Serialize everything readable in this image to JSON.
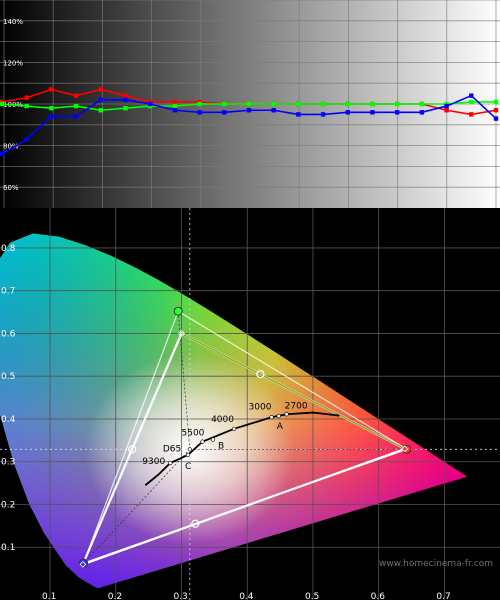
{
  "chart_data": [
    {
      "type": "line",
      "title": "",
      "xlabel": "",
      "ylabel": "",
      "ylim": [
        50,
        150
      ],
      "yticks": [
        "140%",
        "120%",
        "100%",
        "80%",
        "60%"
      ],
      "ytick_values": [
        140,
        120,
        100,
        80,
        60
      ],
      "grid": true,
      "background": "grayscale gradient black to white",
      "x": [
        0,
        1,
        2,
        3,
        4,
        5,
        6,
        7,
        8,
        9,
        10,
        11,
        12,
        13,
        14,
        15,
        16,
        17,
        18,
        19,
        20
      ],
      "series": [
        {
          "color": "#ff0000",
          "values": [
            101,
            103,
            107,
            104,
            107,
            104,
            101,
            101,
            101,
            100,
            100,
            100,
            100,
            100,
            100,
            100,
            100,
            100,
            97,
            95,
            97
          ]
        },
        {
          "color": "#00ff00",
          "values": [
            100,
            99,
            98,
            99,
            97,
            98,
            99,
            99,
            100,
            100,
            100,
            100,
            100,
            100,
            100,
            100,
            100,
            100,
            100,
            101,
            101
          ]
        },
        {
          "color": "#0000ff",
          "values": [
            76,
            83,
            94,
            94,
            102,
            102,
            100,
            97,
            96,
            96,
            97,
            97,
            95,
            95,
            96,
            96,
            96,
            96,
            99,
            104,
            93
          ]
        }
      ]
    },
    {
      "type": "scatter",
      "title": "",
      "xlim": [
        0.03,
        0.78
      ],
      "ylim": [
        0.0,
        0.87
      ],
      "xticks": [
        "0.1",
        "0.2",
        "0.3",
        "0.4",
        "0.5",
        "0.6",
        "0.7"
      ],
      "xtick_values": [
        0.1,
        0.2,
        0.3,
        0.4,
        0.5,
        0.6,
        0.7
      ],
      "yticks": [
        "0.8",
        "0.7",
        "0.6",
        "0.5",
        "0.4",
        "0.3",
        "0.2",
        "0.1"
      ],
      "ytick_values": [
        0.8,
        0.7,
        0.6,
        0.5,
        0.4,
        0.3,
        0.2,
        0.1
      ],
      "grid": true,
      "reference_gamut": [
        [
          0.64,
          0.33
        ],
        [
          0.3,
          0.6
        ],
        [
          0.15,
          0.06
        ]
      ],
      "measured_gamut": [
        [
          0.643,
          0.329
        ],
        [
          0.295,
          0.652
        ],
        [
          0.151,
          0.063
        ]
      ],
      "white_point": [
        0.3127,
        0.329
      ],
      "locus_points": [
        {
          "label": "9300",
          "x": 0.283,
          "y": 0.297
        },
        {
          "label": "D65",
          "x": 0.3127,
          "y": 0.329
        },
        {
          "label": "C",
          "x": 0.31,
          "y": 0.316
        },
        {
          "label": "5500",
          "x": 0.332,
          "y": 0.347
        },
        {
          "label": "B",
          "x": 0.348,
          "y": 0.352
        },
        {
          "label": "4000",
          "x": 0.38,
          "y": 0.377
        },
        {
          "label": "3000",
          "x": 0.437,
          "y": 0.404
        },
        {
          "label": "A",
          "x": 0.448,
          "y": 0.407
        },
        {
          "label": "2700",
          "x": 0.46,
          "y": 0.411
        }
      ],
      "secondary_points": [
        [
          0.225,
          0.329
        ],
        [
          0.42,
          0.505
        ],
        [
          0.321,
          0.155
        ]
      ],
      "watermark": "www.homecinema-fr.com"
    }
  ]
}
